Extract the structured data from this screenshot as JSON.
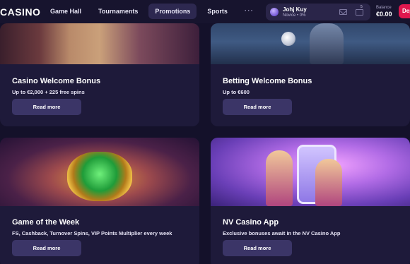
{
  "header": {
    "logo_text": "CASINO",
    "nav": [
      {
        "label": "Game Hall",
        "active": false
      },
      {
        "label": "Tournaments",
        "active": false
      },
      {
        "label": "Promotions",
        "active": true
      },
      {
        "label": "Sports",
        "active": false
      }
    ],
    "more_label": "···",
    "user": {
      "name": "Johj Kuy",
      "level": "Novice • 0%"
    },
    "gift_badge": "5",
    "balance_label": "Balance",
    "balance_value": "€0.00",
    "deposit_label": "Dep"
  },
  "cards": [
    {
      "title": "Casino Welcome Bonus",
      "subtitle": "Up to €2,000 + 225 free spins",
      "button": "Read more"
    },
    {
      "title": "Betting Welcome Bonus",
      "subtitle": "Up to €600",
      "button": "Read more"
    },
    {
      "title": "Game of the Week",
      "subtitle": "FS, Cashback, Turnover Spins, VIP Points Multiplier every week",
      "button": "Read more"
    },
    {
      "title": "NV Casino App",
      "subtitle": "Exclusive bonuses await in the NV Casino App",
      "button": "Read more"
    }
  ],
  "colors": {
    "background": "#14112a",
    "card": "#1e1a3a",
    "button": "#3b3567",
    "active_nav": "#2d2850",
    "deposit": "#e0174e"
  }
}
